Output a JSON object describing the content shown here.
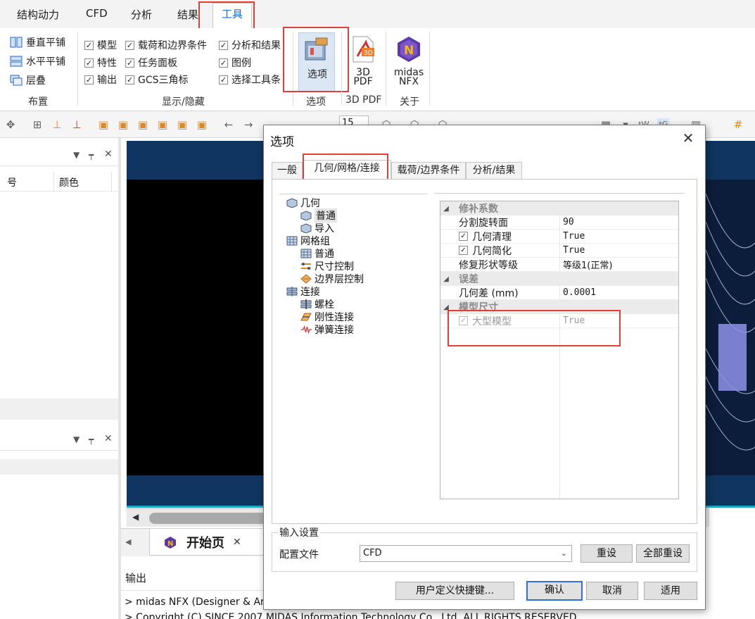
{
  "ribbon": {
    "tabs": [
      "结构动力",
      "CFD",
      "分析",
      "结果",
      "工具"
    ],
    "active_tab": "工具",
    "layout_group": {
      "items": [
        "垂直平铺",
        "水平平铺",
        "层叠"
      ],
      "label": "布置"
    },
    "show_hide_group": {
      "col1": [
        "模型",
        "特性",
        "输出"
      ],
      "col2": [
        "载荷和边界条件",
        "任务面板",
        "GCS三角标"
      ],
      "col3": [
        "分析和结果",
        "图例",
        "选择工具条"
      ],
      "label": "显示/隐藏"
    },
    "options_group": {
      "button": "选项",
      "label": "选项"
    },
    "pdf_group": {
      "button_line1": "3D",
      "button_line2": "PDF",
      "label": "3D PDF"
    },
    "about_group": {
      "button_line1": "midas",
      "button_line2": "NFX",
      "label": "关于"
    }
  },
  "toolbar": {
    "number_field": "15"
  },
  "left_pane": {
    "col_number": "号",
    "col_color": "颜色"
  },
  "document_tab": {
    "label": "开始页"
  },
  "output": {
    "title": "输出",
    "lines": [
      "> midas NFX (Designer & Ana",
      "> Copyright (C) SINCE 2007 MIDAS Information Technology Co., Ltd. ALL RIGHTS RESERVED"
    ]
  },
  "dialog": {
    "title": "选项",
    "tabs": [
      "一般",
      "几何/网格/连接",
      "载荷/边界条件",
      "分析/结果"
    ],
    "active_tab": "几何/网格/连接",
    "tree": [
      {
        "label": "几何",
        "level": 0
      },
      {
        "label": "普通",
        "level": 1,
        "selected": true
      },
      {
        "label": "导入",
        "level": 1
      },
      {
        "label": "网格组",
        "level": 0
      },
      {
        "label": "普通",
        "level": 1
      },
      {
        "label": "尺寸控制",
        "level": 1
      },
      {
        "label": "边界层控制",
        "level": 1
      },
      {
        "label": "连接",
        "level": 0
      },
      {
        "label": "螺栓",
        "level": 1
      },
      {
        "label": "刚性连接",
        "level": 1
      },
      {
        "label": "弹簧连接",
        "level": 1
      }
    ],
    "properties": {
      "cat_repair": "修补系数",
      "split_rotation_label": "分割旋转面",
      "split_rotation_value": "90",
      "geom_clean_label": "几何清理",
      "geom_clean_value": "True",
      "geom_simplify_label": "几何简化",
      "geom_simplify_value": "True",
      "repair_level_label": "修复形状等级",
      "repair_level_value": "等级1(正常)",
      "cat_tolerance": "误差",
      "geom_tol_label": "几何差 (mm)",
      "geom_tol_value": "0.0001",
      "cat_model_size": "模型尺寸",
      "large_model_label": "大型模型",
      "large_model_value": "True"
    },
    "input_settings": {
      "group_label": "输入设置",
      "config_label": "配置文件",
      "config_value": "CFD",
      "reset": "重设",
      "reset_all": "全部重设"
    },
    "buttons": {
      "shortcuts": "用户定义快捷键...",
      "ok": "确认",
      "cancel": "取消",
      "apply": "适用"
    }
  },
  "colors": {
    "highlight_box": "#e0403a",
    "accent_blue": "#1b6fd1",
    "view_banner": "#0f3560"
  }
}
